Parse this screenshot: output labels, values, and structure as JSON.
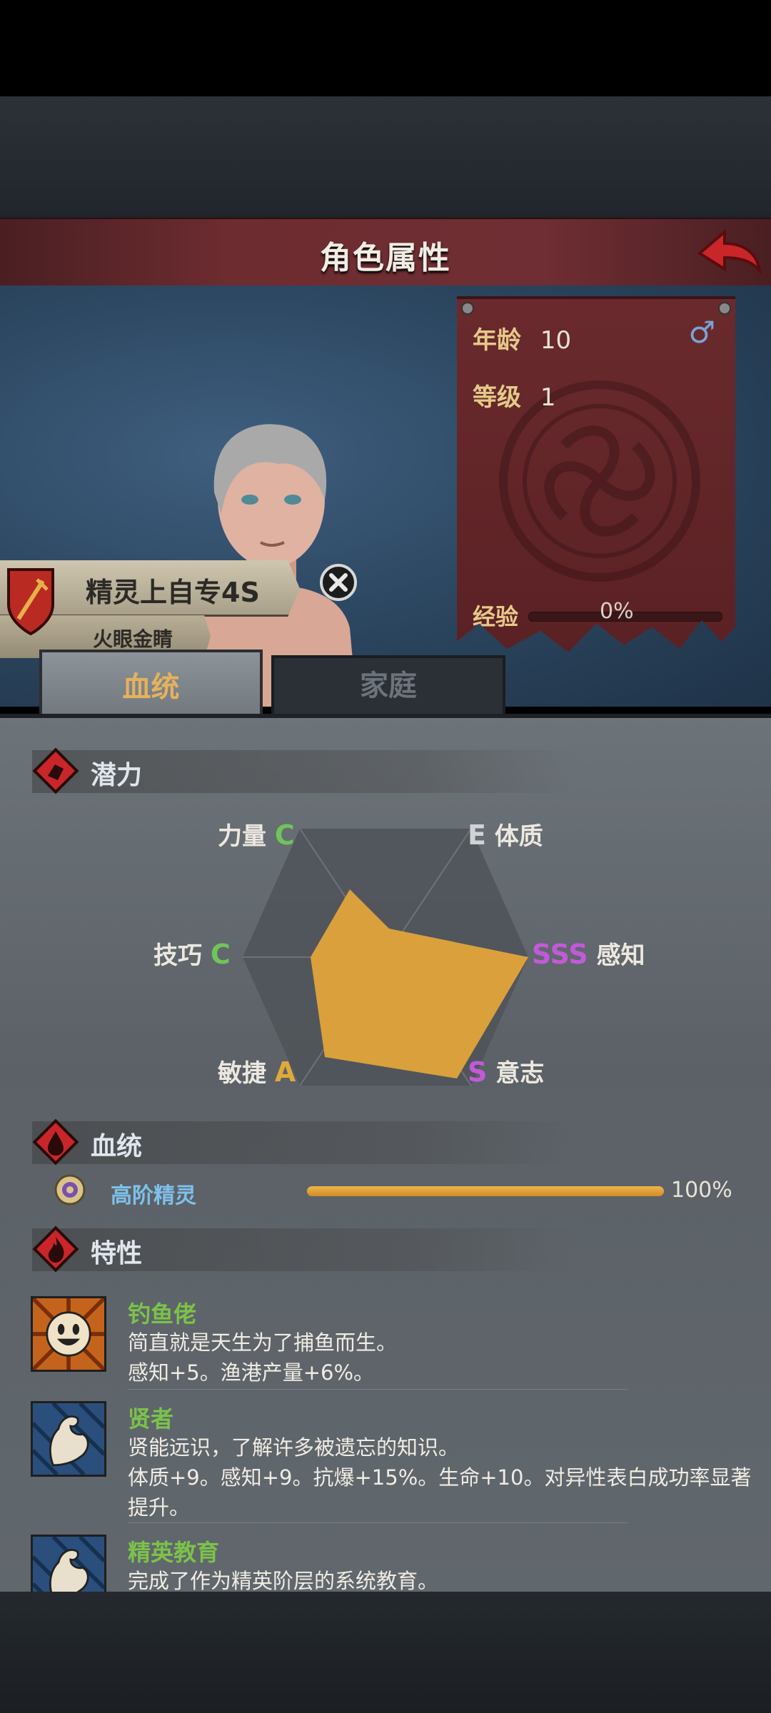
{
  "header": {
    "title": "角色属性",
    "back_icon": "red-curved-arrow-icon"
  },
  "stats": {
    "age_label": "年龄",
    "age_value": "10",
    "level_label": "等级",
    "level_value": "1",
    "gender_icon": "♂",
    "exp_label": "经验",
    "exp_value": "0%",
    "exp_fraction": 0
  },
  "character": {
    "name": "精灵上自专4S",
    "title": "火眼金睛"
  },
  "tabs": [
    {
      "label": "血统",
      "active": true
    },
    {
      "label": "家庭",
      "active": false
    }
  ],
  "potential": {
    "title": "潜力",
    "attributes": [
      {
        "name": "力量",
        "grade": "C",
        "grade_color": "#6fc45a"
      },
      {
        "name": "体质",
        "grade": "E",
        "grade_color": "#cfd3d6"
      },
      {
        "name": "感知",
        "grade": "SSS",
        "grade_color": "#c15ad9"
      },
      {
        "name": "意志",
        "grade": "S",
        "grade_color": "#c15ad9"
      },
      {
        "name": "敏捷",
        "grade": "A",
        "grade_color": "#e0a93a"
      },
      {
        "name": "技巧",
        "grade": "C",
        "grade_color": "#6fc45a"
      }
    ],
    "fill_color": "#d9a03c"
  },
  "bloodline": {
    "title": "血统",
    "name": "高阶精灵",
    "percent_label": "100%",
    "fraction": 1.0
  },
  "traits": {
    "title": "特性",
    "items": [
      {
        "name": "钓鱼佬",
        "lines": [
          "简直就是天生为了捕鱼而生。",
          "感知+5。渔港产量+6%。"
        ],
        "icon": "smiley-sun-icon"
      },
      {
        "name": "贤者",
        "lines": [
          "贤能远识，了解许多被遗忘的知识。",
          "体质+9。感知+9。抗爆+15%。生命+10。对异性表白成功率显著提升。"
        ],
        "icon": "flexed-arm-icon"
      },
      {
        "name": "精英教育",
        "lines": [
          "完成了作为精英阶层的系统教育。"
        ],
        "icon": "flexed-arm-icon"
      }
    ]
  }
}
